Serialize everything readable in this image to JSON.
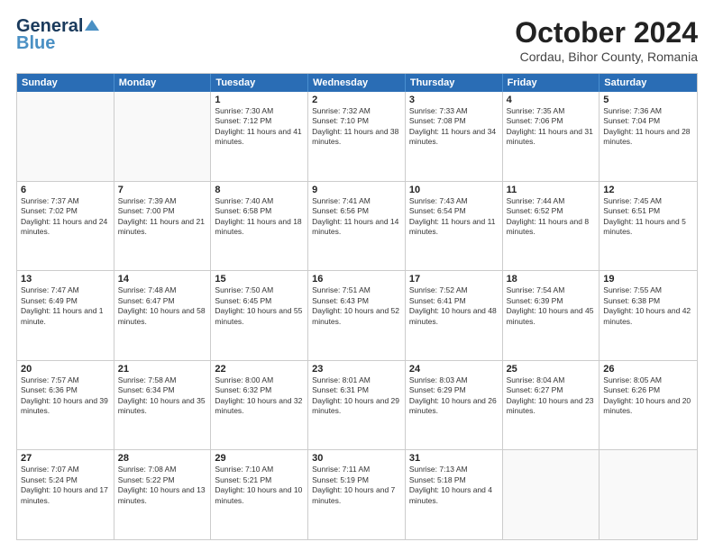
{
  "logo": {
    "line1": "General",
    "line2": "Blue"
  },
  "title": "October 2024",
  "location": "Cordau, Bihor County, Romania",
  "days_of_week": [
    "Sunday",
    "Monday",
    "Tuesday",
    "Wednesday",
    "Thursday",
    "Friday",
    "Saturday"
  ],
  "weeks": [
    [
      {
        "day": "",
        "info": ""
      },
      {
        "day": "",
        "info": ""
      },
      {
        "day": "1",
        "info": "Sunrise: 7:30 AM\nSunset: 7:12 PM\nDaylight: 11 hours and 41 minutes."
      },
      {
        "day": "2",
        "info": "Sunrise: 7:32 AM\nSunset: 7:10 PM\nDaylight: 11 hours and 38 minutes."
      },
      {
        "day": "3",
        "info": "Sunrise: 7:33 AM\nSunset: 7:08 PM\nDaylight: 11 hours and 34 minutes."
      },
      {
        "day": "4",
        "info": "Sunrise: 7:35 AM\nSunset: 7:06 PM\nDaylight: 11 hours and 31 minutes."
      },
      {
        "day": "5",
        "info": "Sunrise: 7:36 AM\nSunset: 7:04 PM\nDaylight: 11 hours and 28 minutes."
      }
    ],
    [
      {
        "day": "6",
        "info": "Sunrise: 7:37 AM\nSunset: 7:02 PM\nDaylight: 11 hours and 24 minutes."
      },
      {
        "day": "7",
        "info": "Sunrise: 7:39 AM\nSunset: 7:00 PM\nDaylight: 11 hours and 21 minutes."
      },
      {
        "day": "8",
        "info": "Sunrise: 7:40 AM\nSunset: 6:58 PM\nDaylight: 11 hours and 18 minutes."
      },
      {
        "day": "9",
        "info": "Sunrise: 7:41 AM\nSunset: 6:56 PM\nDaylight: 11 hours and 14 minutes."
      },
      {
        "day": "10",
        "info": "Sunrise: 7:43 AM\nSunset: 6:54 PM\nDaylight: 11 hours and 11 minutes."
      },
      {
        "day": "11",
        "info": "Sunrise: 7:44 AM\nSunset: 6:52 PM\nDaylight: 11 hours and 8 minutes."
      },
      {
        "day": "12",
        "info": "Sunrise: 7:45 AM\nSunset: 6:51 PM\nDaylight: 11 hours and 5 minutes."
      }
    ],
    [
      {
        "day": "13",
        "info": "Sunrise: 7:47 AM\nSunset: 6:49 PM\nDaylight: 11 hours and 1 minute."
      },
      {
        "day": "14",
        "info": "Sunrise: 7:48 AM\nSunset: 6:47 PM\nDaylight: 10 hours and 58 minutes."
      },
      {
        "day": "15",
        "info": "Sunrise: 7:50 AM\nSunset: 6:45 PM\nDaylight: 10 hours and 55 minutes."
      },
      {
        "day": "16",
        "info": "Sunrise: 7:51 AM\nSunset: 6:43 PM\nDaylight: 10 hours and 52 minutes."
      },
      {
        "day": "17",
        "info": "Sunrise: 7:52 AM\nSunset: 6:41 PM\nDaylight: 10 hours and 48 minutes."
      },
      {
        "day": "18",
        "info": "Sunrise: 7:54 AM\nSunset: 6:39 PM\nDaylight: 10 hours and 45 minutes."
      },
      {
        "day": "19",
        "info": "Sunrise: 7:55 AM\nSunset: 6:38 PM\nDaylight: 10 hours and 42 minutes."
      }
    ],
    [
      {
        "day": "20",
        "info": "Sunrise: 7:57 AM\nSunset: 6:36 PM\nDaylight: 10 hours and 39 minutes."
      },
      {
        "day": "21",
        "info": "Sunrise: 7:58 AM\nSunset: 6:34 PM\nDaylight: 10 hours and 35 minutes."
      },
      {
        "day": "22",
        "info": "Sunrise: 8:00 AM\nSunset: 6:32 PM\nDaylight: 10 hours and 32 minutes."
      },
      {
        "day": "23",
        "info": "Sunrise: 8:01 AM\nSunset: 6:31 PM\nDaylight: 10 hours and 29 minutes."
      },
      {
        "day": "24",
        "info": "Sunrise: 8:03 AM\nSunset: 6:29 PM\nDaylight: 10 hours and 26 minutes."
      },
      {
        "day": "25",
        "info": "Sunrise: 8:04 AM\nSunset: 6:27 PM\nDaylight: 10 hours and 23 minutes."
      },
      {
        "day": "26",
        "info": "Sunrise: 8:05 AM\nSunset: 6:26 PM\nDaylight: 10 hours and 20 minutes."
      }
    ],
    [
      {
        "day": "27",
        "info": "Sunrise: 7:07 AM\nSunset: 5:24 PM\nDaylight: 10 hours and 17 minutes."
      },
      {
        "day": "28",
        "info": "Sunrise: 7:08 AM\nSunset: 5:22 PM\nDaylight: 10 hours and 13 minutes."
      },
      {
        "day": "29",
        "info": "Sunrise: 7:10 AM\nSunset: 5:21 PM\nDaylight: 10 hours and 10 minutes."
      },
      {
        "day": "30",
        "info": "Sunrise: 7:11 AM\nSunset: 5:19 PM\nDaylight: 10 hours and 7 minutes."
      },
      {
        "day": "31",
        "info": "Sunrise: 7:13 AM\nSunset: 5:18 PM\nDaylight: 10 hours and 4 minutes."
      },
      {
        "day": "",
        "info": ""
      },
      {
        "day": "",
        "info": ""
      }
    ]
  ]
}
